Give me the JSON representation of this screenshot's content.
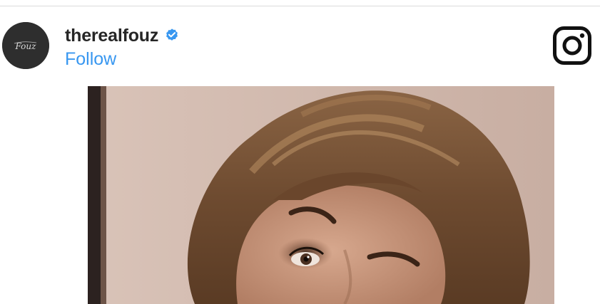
{
  "post_header": {
    "username": "therealfouz",
    "follow_label": "Follow",
    "verified": true,
    "verified_icon": "verified-badge-icon",
    "brand_icon": "instagram-icon",
    "avatar_text": "Fouz"
  },
  "colors": {
    "follow_blue": "#3897f0",
    "username_text": "#262626",
    "verified_blue": "#3897f0",
    "divider": "#dbdbdb",
    "avatar_bg": "#2e2e2e"
  },
  "media": {
    "type": "photo"
  }
}
